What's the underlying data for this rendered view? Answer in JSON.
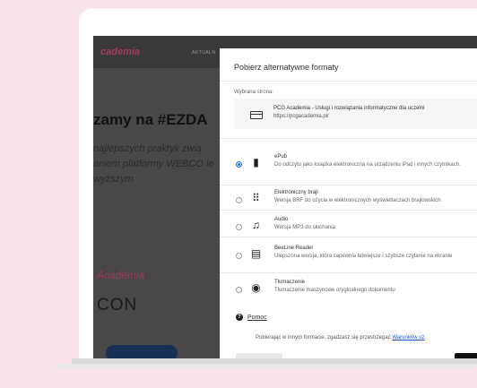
{
  "site": {
    "logo": "cademia",
    "nav": "AKTUALN",
    "hero_title": "zamy na #EZDA",
    "hero_text": "najlepszych praktyk zwią aniem platformy WEBCO ie wyższym",
    "brand": "Academia",
    "con": "CON"
  },
  "modal": {
    "title": "Pobierz alternatywne formaty",
    "selected_label": "Wybrana strona:",
    "page_title": "PCG Academia - Usługi i rozwiązania informatyczne dla uczelni",
    "page_url": "https://pcgacademia.pl/",
    "formats": [
      {
        "name": "ePub",
        "desc": "Do odczytu jako książka elektroniczna na urządzeniu iPad i innych czytnikach.",
        "icon": "book-icon",
        "selected": true
      },
      {
        "name": "Elektroniczny brajl",
        "desc": "Wersja BRF do użycia w elektronicznych wyświetlaczach brajlowskich",
        "icon": "braille-icon",
        "selected": false
      },
      {
        "name": "Audio",
        "desc": "Wersja MP3 do słuchania",
        "icon": "audio-icon",
        "selected": false
      },
      {
        "name": "BeeLine Reader",
        "desc": "Ulepszona wersja, która zapewnia łatwiejsze i szybsze czytanie na ekranie",
        "icon": "beeline-icon",
        "selected": false
      },
      {
        "name": "Tłumaczenie",
        "desc": "Tłumaczenie maszynowe oryginalnego dokumentu",
        "icon": "translate-icon",
        "selected": false
      }
    ],
    "help": "Pomoc",
    "agree_text": "Pobierając w innym formacie, zgadzasz się przestrzegać",
    "agree_link": "Warunków uż"
  },
  "colors": {
    "background": "#fbe3ea",
    "accent": "#1a73e8",
    "brand": "#a33d58"
  }
}
